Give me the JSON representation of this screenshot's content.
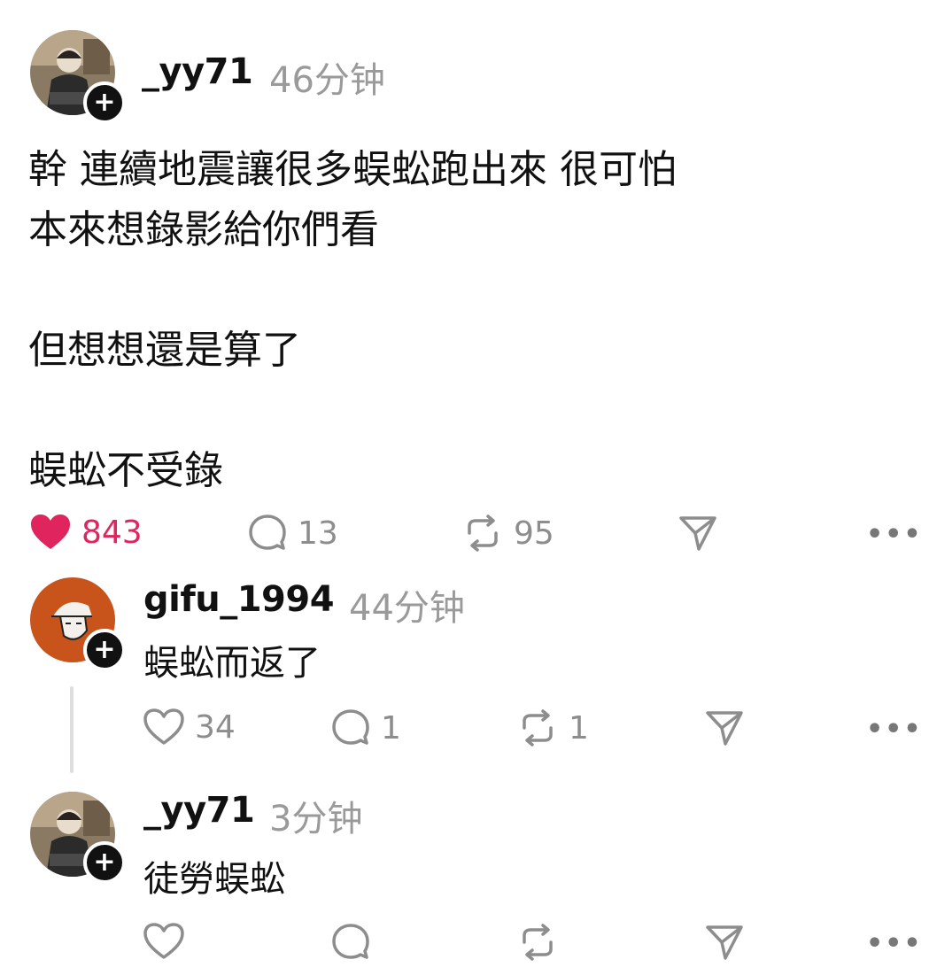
{
  "post": {
    "username": "_yy71",
    "timestamp": "46分钟",
    "lines": [
      "幹 連續地震讓很多蜈蚣跑出來 很可怕",
      "本來想錄影給你們看",
      "",
      "但想想還是算了",
      "",
      "蜈蚣不受錄"
    ],
    "likes": "843",
    "comments": "13",
    "reposts": "95",
    "liked": true
  },
  "replies": [
    {
      "username": "gifu_1994",
      "timestamp": "44分钟",
      "text": "蜈蚣而返了",
      "likes": "34",
      "comments": "1",
      "reposts": "1"
    },
    {
      "username": "_yy71",
      "timestamp": "3分钟",
      "text": "徒勞蜈蚣",
      "likes": "",
      "comments": "",
      "reposts": ""
    }
  ],
  "icons": {
    "heart": "heart-icon",
    "comment": "comment-bubble-icon",
    "repost": "repost-icon",
    "share": "paper-plane-icon",
    "more": "more-dots-icon",
    "follow": "plus-icon"
  },
  "colors": {
    "liked": "#e0245e",
    "muted": "#9a9a9a",
    "text": "#111111"
  },
  "follow_symbol": "+",
  "more_symbol": "•••"
}
